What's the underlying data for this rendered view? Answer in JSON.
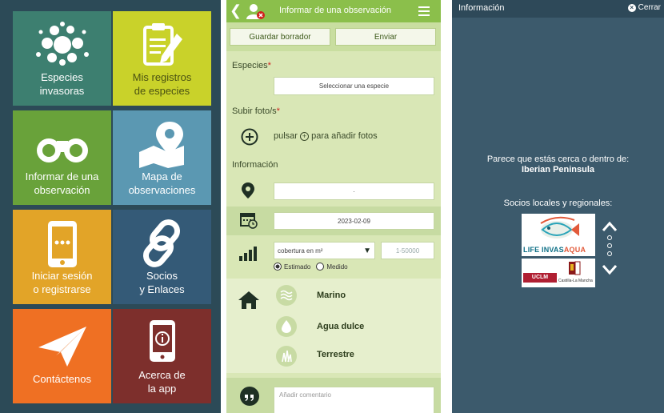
{
  "home": {
    "tiles": [
      {
        "label_1": "Especies",
        "label_2": "invasoras",
        "icon": "cluster-dots-icon"
      },
      {
        "label_1": "Mis registros",
        "label_2": "de especies",
        "icon": "clipboard-edit-icon"
      },
      {
        "label_1": "Informar de una",
        "label_2": "observación",
        "icon": "binoculars-icon"
      },
      {
        "label_1": "Mapa de",
        "label_2": "observaciones",
        "icon": "map-pin-icon"
      },
      {
        "label_1": "Iniciar sesión",
        "label_2": "o registrarse",
        "icon": "phone-icon"
      },
      {
        "label_1": "Socios",
        "label_2": "y Enlaces",
        "icon": "link-icon"
      },
      {
        "label_1": "Contáctenos",
        "label_2": "",
        "icon": "paper-plane-icon"
      },
      {
        "label_1": "Acerca de",
        "label_2": "la app",
        "icon": "info-phone-icon"
      }
    ]
  },
  "form": {
    "title": "Informar de una observación",
    "save_draft": "Guardar borrador",
    "send": "Enviar",
    "species_label": "Especies",
    "required_mark": "*",
    "species_select": "Seleccionar una especie",
    "photos_label": "Subir foto/s",
    "add_photos_text_1": "pulsar",
    "add_photos_text_2": "para añadir fotos",
    "info_label": "Información",
    "location_value": "·",
    "date_value": "2023-02-09",
    "coverage_select": "cobertura en m²",
    "coverage_placeholder": "1-50000",
    "radio_estimated": "Estimado",
    "radio_measured": "Medido",
    "habitat_marine": "Marino",
    "habitat_freshwater": "Agua dulce",
    "habitat_terrestrial": "Terrestre",
    "comment_placeholder": "Añadir comentario"
  },
  "info": {
    "header_title": "Información",
    "close": "Cerrar",
    "near_text": "Parece que estás cerca o dentro de:",
    "region": "Iberian Peninsula",
    "partners_label": "Socios locales y regionales:",
    "logo_invasaqua_1": "LIFE INVAS",
    "logo_invasaqua_2": "AQUA",
    "logo_uclm": "UCLM",
    "logo_clm": "Castilla-La Mancha"
  },
  "colors": {
    "form_accent": "#8bbf4b",
    "info_bg": "#3c5a6c"
  }
}
